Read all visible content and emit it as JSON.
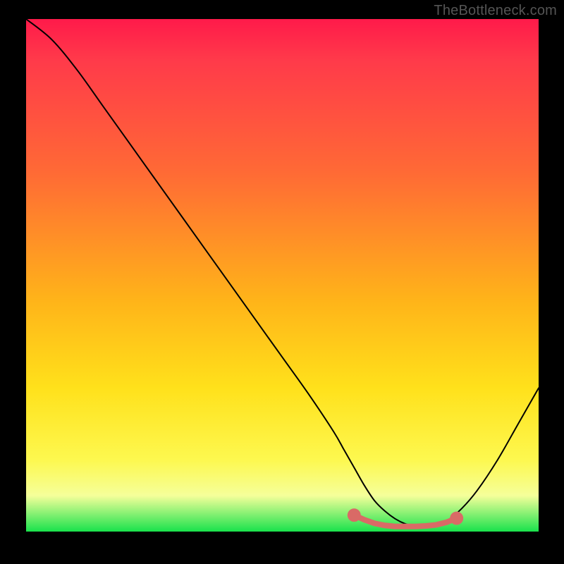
{
  "watermark": "TheBottleneck.com",
  "chart_data": {
    "type": "line",
    "title": "",
    "xlabel": "",
    "ylabel": "",
    "xlim": [
      0,
      100
    ],
    "ylim": [
      0,
      100
    ],
    "series": [
      {
        "name": "bottleneck-curve",
        "x": [
          0,
          5,
          10,
          15,
          20,
          25,
          30,
          35,
          40,
          45,
          50,
          55,
          60,
          62,
          64,
          66,
          68,
          70,
          72,
          74,
          76,
          78,
          80,
          82,
          85,
          88,
          92,
          96,
          100
        ],
        "y": [
          100,
          96,
          90,
          83,
          76,
          69,
          62,
          55,
          48,
          41,
          34,
          27,
          19.5,
          16,
          12.5,
          9,
          6,
          4,
          2.5,
          1.5,
          1,
          1,
          1.2,
          2,
          4.5,
          8,
          14,
          21,
          28
        ]
      }
    ],
    "markers": {
      "name": "highlight-zone",
      "x": [
        64,
        66,
        68,
        70,
        72,
        74,
        76,
        78,
        80,
        82,
        84
      ],
      "y": [
        3.2,
        2.3,
        1.6,
        1.2,
        1.0,
        1.0,
        1.0,
        1.1,
        1.3,
        1.8,
        2.6
      ]
    },
    "gradient_colors": [
      "#ff1a4a",
      "#ffe11b",
      "#19e24c"
    ]
  }
}
